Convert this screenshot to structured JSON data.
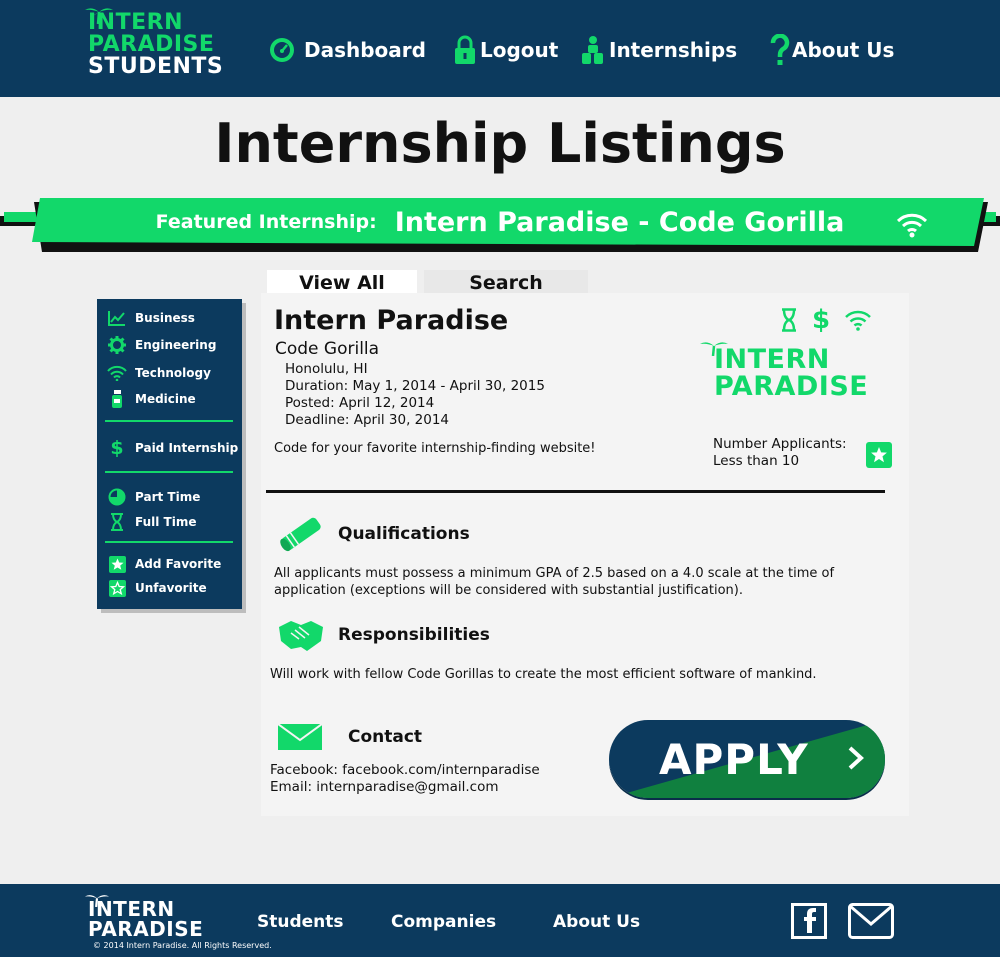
{
  "colors": {
    "navy": "#0c3a5e",
    "green": "#12d86a",
    "bg": "#efefef"
  },
  "header": {
    "logo": {
      "line1": "INTERN",
      "line2": "PARADISE",
      "line3": "STUDENTS"
    },
    "nav": [
      {
        "label": "Dashboard",
        "icon": "dashboard-gauge-icon"
      },
      {
        "label": "Logout",
        "icon": "lock-icon"
      },
      {
        "label": "Internships",
        "icon": "people-icon"
      },
      {
        "label": "About Us",
        "icon": "question-mark-icon"
      }
    ]
  },
  "page_title": "Internship Listings",
  "featured": {
    "label": "Featured Internship:",
    "value": "Intern Paradise - Code Gorilla",
    "icon": "wifi-icon"
  },
  "tabs": {
    "view_all": "View All",
    "search": "Search"
  },
  "sidebar": {
    "items": [
      {
        "label": "Business",
        "icon": "line-chart-icon"
      },
      {
        "label": "Engineering",
        "icon": "gear-icon"
      },
      {
        "label": "Technology",
        "icon": "wifi-icon"
      },
      {
        "label": "Medicine",
        "icon": "medicine-bottle-icon"
      },
      {
        "label": "Paid Internship",
        "icon": "dollar-icon"
      },
      {
        "label": "Part Time",
        "icon": "pie-chart-icon"
      },
      {
        "label": "Full Time",
        "icon": "hourglass-icon"
      },
      {
        "label": "Add Favorite",
        "icon": "star-filled-icon"
      },
      {
        "label": "Unfavorite",
        "icon": "star-outline-icon"
      }
    ]
  },
  "listing": {
    "company": "Intern Paradise",
    "position": "Code Gorilla",
    "location": "Honolulu, HI",
    "duration": "Duration: May 1, 2014 - April 30, 2015",
    "posted": "Posted: April 12, 2014",
    "deadline": "Deadline: April 30, 2014",
    "description": "Code for your favorite internship-finding website!",
    "tag_icons": [
      "hourglass-icon",
      "dollar-icon",
      "wifi-icon"
    ],
    "logo": {
      "line1": "INTERN",
      "line2": "PARADISE"
    },
    "applicants_label": "Number Applicants:",
    "applicants_value": "Less than 10",
    "qualifications": {
      "title": "Qualifications",
      "text": "All applicants must possess a minimum GPA of 2.5 based on a 4.0 scale at the time of application (exceptions will be considered with substantial justification)."
    },
    "responsibilities": {
      "title": "Responsibilities",
      "text": "Will work with fellow Code Gorillas to create the most efficient software of mankind."
    },
    "contact": {
      "title": "Contact",
      "facebook": "Facebook: facebook.com/internparadise",
      "email": "Email: internparadise@gmail.com"
    },
    "apply_label": "APPLY"
  },
  "footer": {
    "logo": {
      "line1": "INTERN",
      "line2": "PARADISE"
    },
    "links": [
      "Students",
      "Companies",
      "About Us"
    ],
    "copyright": "© 2014 Intern Paradise. All Rights Reserved."
  }
}
